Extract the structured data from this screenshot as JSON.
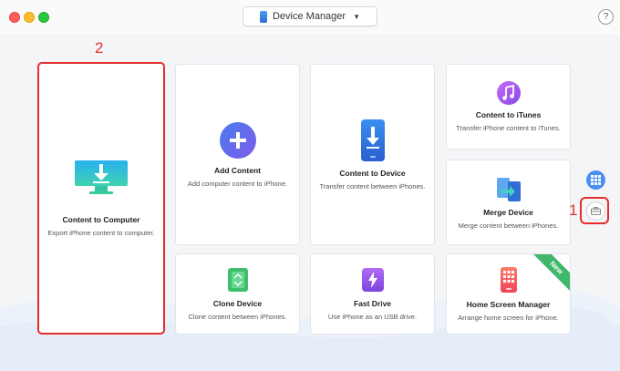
{
  "titlebar": {
    "device_button_label": "Device Manager",
    "help_label": "?"
  },
  "cards": {
    "content_to_computer": {
      "title": "Content to Computer",
      "desc": "Export iPhone content to computer."
    },
    "add_content": {
      "title": "Add Content",
      "desc": "Add computer content to iPhone."
    },
    "content_to_device": {
      "title": "Content to Device",
      "desc": "Transfer content between iPhones."
    },
    "content_to_itunes": {
      "title": "Content to iTunes",
      "desc": "Transfer iPhone content to iTunes."
    },
    "merge_device": {
      "title": "Merge Device",
      "desc": "Merge content between iPhones."
    },
    "clone_device": {
      "title": "Clone Device",
      "desc": "Clone content between iPhones."
    },
    "fast_drive": {
      "title": "Fast Drive",
      "desc": "Use iPhone as an USB drive."
    },
    "home_screen_manager": {
      "title": "Home Screen Manager",
      "desc": "Arrange home screen for iPhone.",
      "badge": "New"
    }
  },
  "annotations": {
    "callout_1": "1",
    "callout_2": "2"
  },
  "colors": {
    "accent_red": "#e52d2d",
    "badge_green": "#3fb86b"
  }
}
